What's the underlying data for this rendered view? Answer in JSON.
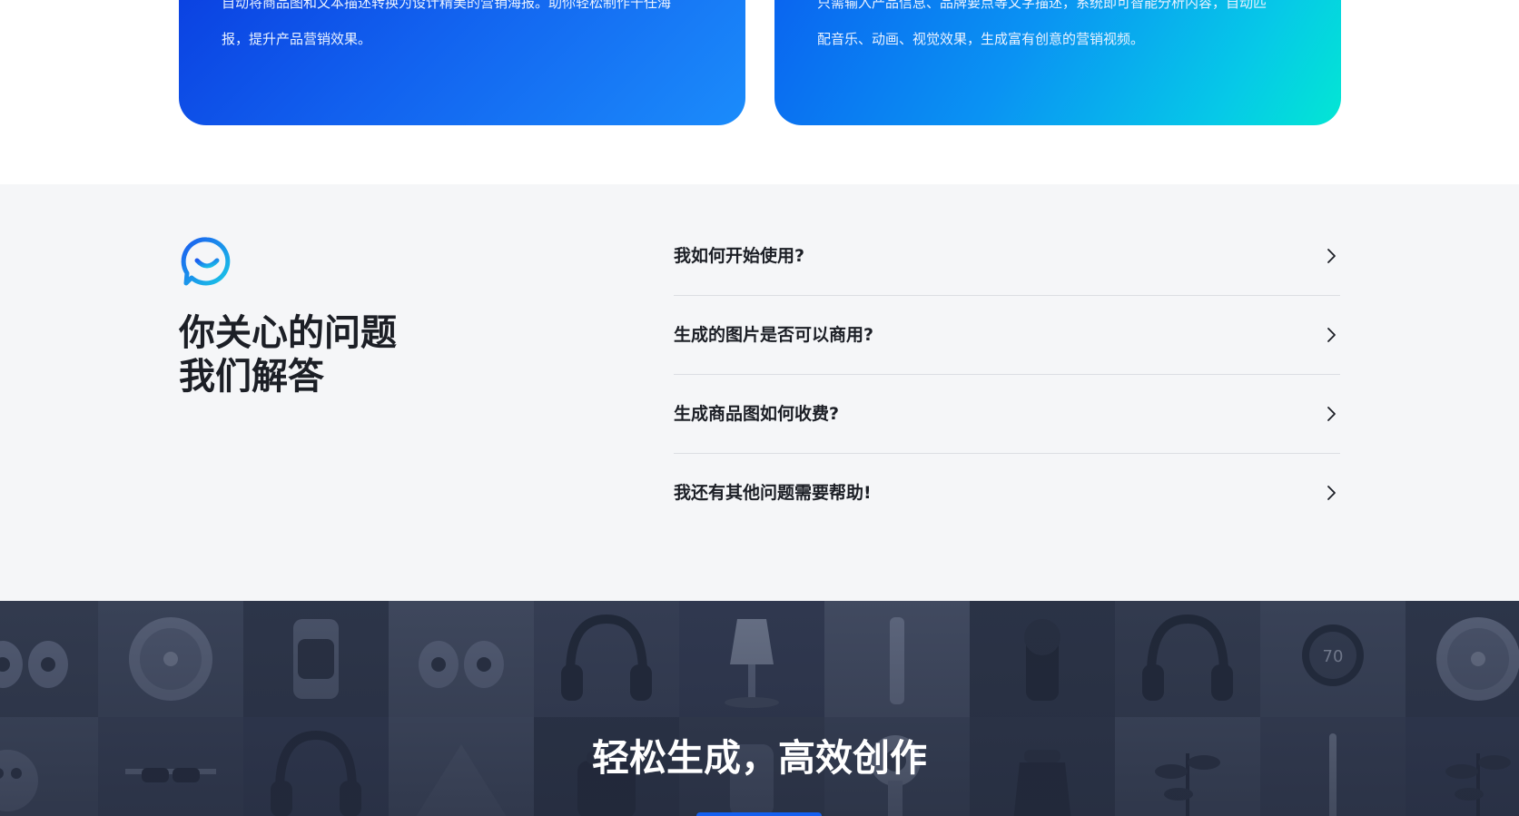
{
  "features": {
    "poster": {
      "desc_line1": "自动将商品图和文本描述转换为设计精美的营销海报。助你轻松制作千任海",
      "desc_line2": "报，提升产品营销效果。"
    },
    "video": {
      "desc_line1": "只需输入产品信息、品牌要点等文字描述，系统即可智能分析内容，自动匹",
      "desc_line2": "配音乐、动画、视觉效果，生成富有创意的营销视频。"
    }
  },
  "faq": {
    "icon": "chat-smile-icon",
    "title_line1": "你关心的问题",
    "title_line2": "我们解答",
    "items": [
      {
        "question": "我如何开始使用?"
      },
      {
        "question": "生成的图片是否可以商用?"
      },
      {
        "question": "生成商品图如何收费?"
      },
      {
        "question": "我还有其他问题需要帮助!"
      }
    ],
    "chevron_icon": "chevron-right-icon"
  },
  "banner": {
    "title": "轻松生成，高效创作",
    "thermostat_reading": "70"
  },
  "colors": {
    "brand_blue": "#1560f0",
    "faq_bg": "#f5f6f8",
    "banner_bg": "#2b3447"
  }
}
